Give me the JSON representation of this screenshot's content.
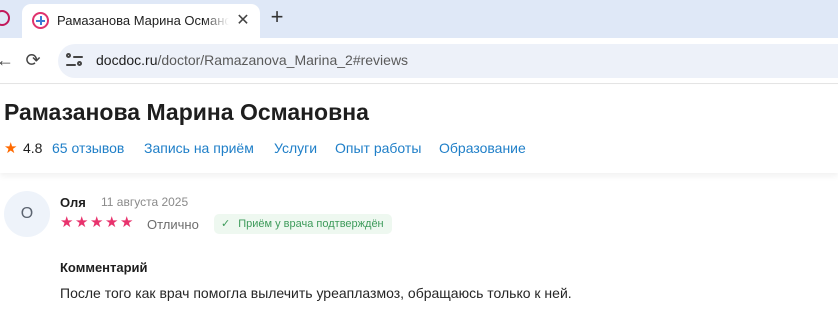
{
  "browser": {
    "tab_title": "Рамазанова Марина Османовна",
    "close_glyph": "✕",
    "new_tab_glyph": "+",
    "reload_glyph": "⟳",
    "back_glyph": "←",
    "url_domain": "docdoc.ru",
    "url_path": "/doctor/Ramazanova_Marina_2#reviews"
  },
  "doctor": {
    "name": "Рамазанова Марина Османовна",
    "rating": "4.8",
    "star_glyph": "★",
    "star_color": "#ff6a00"
  },
  "nav": {
    "reviews": "65 отзывов",
    "appointment": "Запись на приём",
    "services": "Услуги",
    "experience": "Опыт работы",
    "education": "Образование",
    "link_color": "#1f7fc8"
  },
  "review": {
    "avatar_letter": "О",
    "author": "Оля",
    "date": "11 августа 2025",
    "stars": 5,
    "star_glyph": "★",
    "star_color": "#e8336d",
    "grade": "Отлично",
    "verified_check": "✓",
    "verified": "Приём у врача подтверждён",
    "comment_heading": "Комментарий",
    "comment_text": "После того как врач помогла вылечить уреаплазмоз, обращаюсь только к ней."
  }
}
